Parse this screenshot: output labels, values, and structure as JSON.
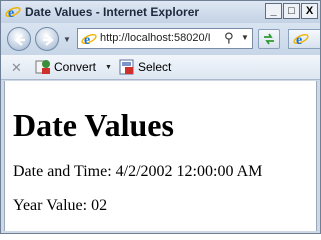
{
  "window": {
    "title": "Date Values - Internet Explorer"
  },
  "window_controls": {
    "minimize": "_",
    "maximize": "□",
    "close": "X"
  },
  "address_bar": {
    "url": "http://localhost:58020/I"
  },
  "command_bar": {
    "convert_label": "Convert",
    "select_label": "Select"
  },
  "page": {
    "heading": "Date Values",
    "date_time_line": "Date and Time: 4/2/2002 12:00:00 AM",
    "year_line": "Year Value: 02"
  },
  "icons": {
    "app": "ie-logo-icon",
    "back": "back-arrow-icon",
    "forward": "forward-arrow-icon",
    "refresh": "refresh-icon",
    "search": "search-icon",
    "convert": "pdf-convert-icon",
    "select": "pdf-select-icon",
    "close": "close-icon"
  },
  "colors": {
    "ie_blue": "#1a6fd0",
    "ie_ring": "#f0b400",
    "title_text": "#1d2a3d"
  }
}
